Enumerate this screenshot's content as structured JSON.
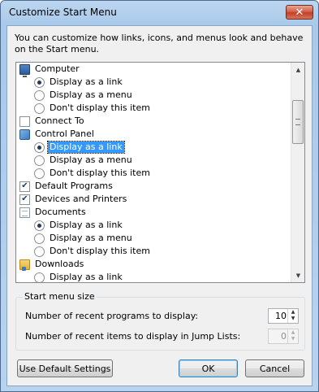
{
  "window": {
    "title": "Customize Start Menu",
    "close_glyph": "✕"
  },
  "description": "You can customize how links, icons, and menus look and behave on the Start menu.",
  "list_items": [
    {
      "kind": "header",
      "icon": "computer-icon",
      "label": "Computer"
    },
    {
      "kind": "radio",
      "checked": true,
      "label": "Display as a link"
    },
    {
      "kind": "radio",
      "checked": false,
      "label": "Display as a menu"
    },
    {
      "kind": "radio",
      "checked": false,
      "label": "Don't display this item"
    },
    {
      "kind": "checkbox",
      "checked": false,
      "label": "Connect To"
    },
    {
      "kind": "header",
      "icon": "control-panel-icon",
      "label": "Control Panel"
    },
    {
      "kind": "radio",
      "checked": true,
      "selected": true,
      "label": "Display as a link"
    },
    {
      "kind": "radio",
      "checked": false,
      "label": "Display as a menu"
    },
    {
      "kind": "radio",
      "checked": false,
      "label": "Don't display this item"
    },
    {
      "kind": "checkbox",
      "checked": true,
      "label": "Default Programs"
    },
    {
      "kind": "checkbox",
      "checked": true,
      "label": "Devices and Printers"
    },
    {
      "kind": "header",
      "icon": "documents-icon",
      "label": "Documents"
    },
    {
      "kind": "radio",
      "checked": true,
      "label": "Display as a link"
    },
    {
      "kind": "radio",
      "checked": false,
      "label": "Display as a menu"
    },
    {
      "kind": "radio",
      "checked": false,
      "label": "Don't display this item"
    },
    {
      "kind": "header",
      "icon": "downloads-icon",
      "label": "Downloads"
    },
    {
      "kind": "radio",
      "checked": false,
      "label": "Display as a link"
    }
  ],
  "start_menu_size": {
    "title": "Start menu size",
    "recent_programs_label": "Number of recent programs to display:",
    "recent_programs_value": "10",
    "recent_items_label": "Number of recent items to display in Jump Lists:",
    "recent_items_value": "0"
  },
  "buttons": {
    "defaults": "Use Default Settings",
    "ok": "OK",
    "cancel": "Cancel"
  }
}
